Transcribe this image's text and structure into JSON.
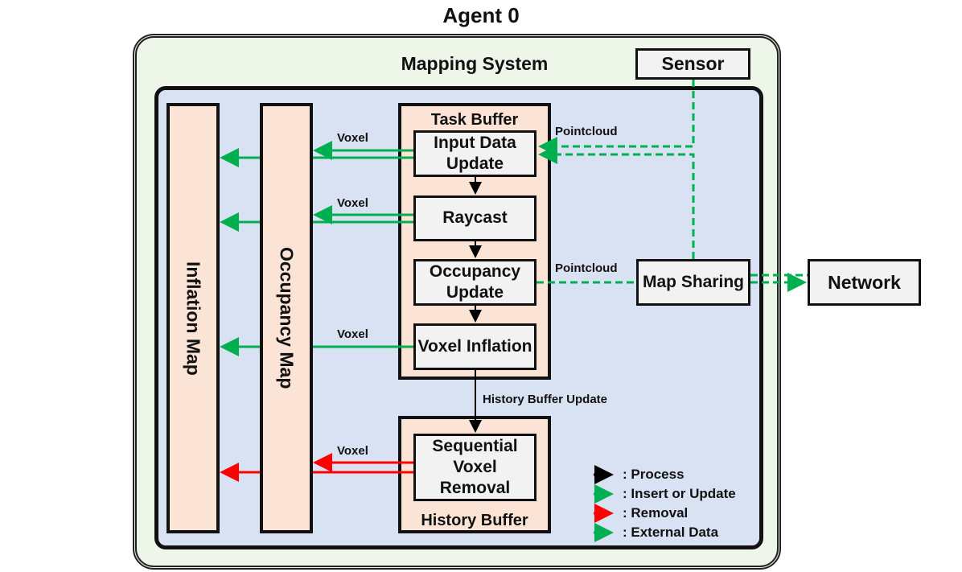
{
  "title": "Agent 0",
  "system": {
    "label": "Mapping System",
    "sensor": "Sensor",
    "network": "Network",
    "map_sharing": "Map Sharing",
    "maps": {
      "inflation": "Inflation Map",
      "occupancy": "Occupancy Map"
    },
    "task_buffer": {
      "label": "Task Buffer",
      "steps": [
        "Input Data Update",
        "Raycast",
        "Occupancy Update",
        "Voxel Inflation"
      ]
    },
    "history_buffer": {
      "label": "History Buffer",
      "steps": [
        "Sequential Voxel Removal"
      ]
    },
    "edge_labels": {
      "voxel": "Voxel",
      "pointcloud": "Pointcloud",
      "history_update": "History Buffer Update"
    }
  },
  "legend": [
    {
      "label": ": Process",
      "color": "#000000",
      "style": "solid"
    },
    {
      "label": ": Insert or Update",
      "color": "#00b050",
      "style": "solid"
    },
    {
      "label": ": Removal",
      "color": "#ff0000",
      "style": "solid"
    },
    {
      "label": ": External Data",
      "color": "#00b050",
      "style": "dashed"
    }
  ],
  "colors": {
    "insert": "#00b050",
    "removal": "#ff0000",
    "process": "#000000"
  }
}
